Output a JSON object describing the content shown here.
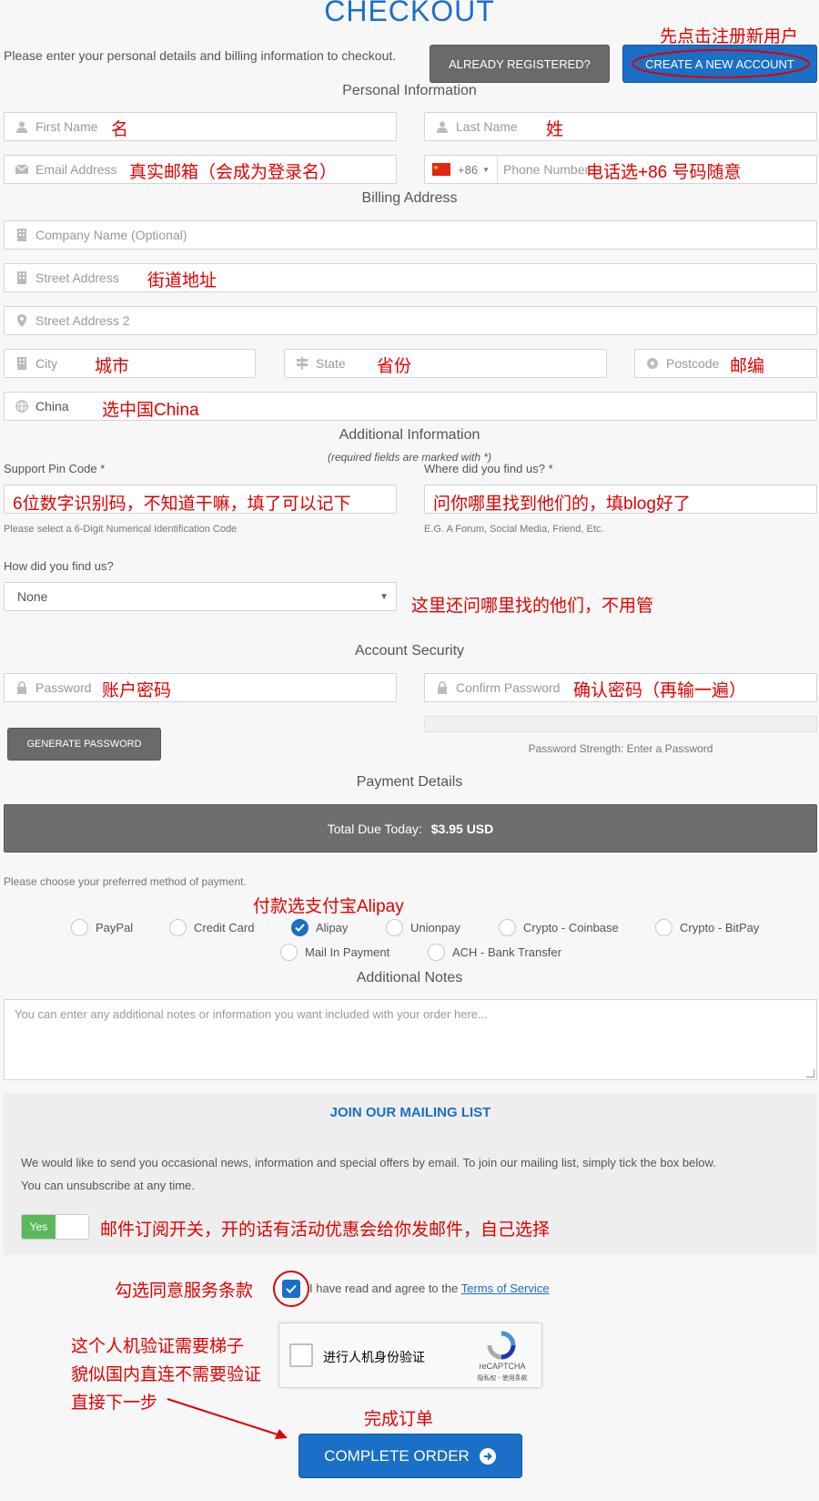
{
  "header": {
    "title": "CHECKOUT",
    "intro": "Please enter your personal details and billing information to checkout.",
    "already_registered": "ALREADY REGISTERED?",
    "create_account": "CREATE A NEW ACCOUNT"
  },
  "sections": {
    "personal": "Personal Information",
    "billing": "Billing Address",
    "additional": "Additional Information",
    "required_note": "(required fields are marked with *)",
    "security": "Account Security",
    "payment": "Payment Details",
    "notes": "Additional Notes"
  },
  "personal": {
    "first_name": "First Name",
    "last_name": "Last Name",
    "email": "Email Address",
    "phone_code": "+86",
    "phone": "Phone Number"
  },
  "billing": {
    "company": "Company Name (Optional)",
    "street": "Street Address",
    "street2": "Street Address 2",
    "city": "City",
    "state": "State",
    "postcode": "Postcode",
    "country": "China"
  },
  "additional": {
    "pin_label": "Support Pin Code *",
    "pin_help": "Please select a 6-Digit Numerical Identification Code",
    "where_label": "Where did you find us? *",
    "where_help": "E.G. A Forum, Social Media, Friend, Etc.",
    "how_label": "How did you find us?",
    "how_value": "None"
  },
  "security": {
    "password": "Password",
    "confirm": "Confirm Password",
    "generate": "GENERATE PASSWORD",
    "strength": "Password Strength: Enter a Password"
  },
  "payment": {
    "total_label": "Total Due Today:",
    "total_value": "$3.95 USD",
    "choose": "Please choose your preferred method of payment.",
    "methods": [
      "PayPal",
      "Credit Card",
      "Alipay",
      "Unionpay",
      "Crypto - Coinbase",
      "Crypto - BitPay",
      "Mail In Payment",
      "ACH - Bank Transfer"
    ],
    "selected": "Alipay"
  },
  "notes": {
    "placeholder": "You can enter any additional notes or information you want included with your order here..."
  },
  "mailing": {
    "title": "JOIN OUR MAILING LIST",
    "text1": "We would like to send you occasional news, information and special offers by email. To join our mailing list, simply tick the box below.",
    "text2": "You can unsubscribe at any time.",
    "toggle_yes": "Yes"
  },
  "tos": {
    "text": "I have read and agree to the",
    "link": "Terms of Service"
  },
  "captcha": {
    "label": "进行人机身份验证",
    "brand": "reCAPTCHA",
    "links": "隐私权 - 使用条款"
  },
  "complete": "COMPLETE ORDER",
  "annotations": {
    "create": "先点击注册新用户",
    "first_name": "名",
    "last_name": "姓",
    "email": "真实邮箱（会成为登录名）",
    "phone": "电话选+86 号码随意",
    "street": "街道地址",
    "city": "城市",
    "state": "省份",
    "postcode": "邮编",
    "country": "选中国China",
    "pin": "6位数字识别码，不知道干嘛，填了可以记下",
    "where": "问你哪里找到他们的，填blog好了",
    "how": "这里还问哪里找的他们，不用管",
    "password": "账户密码",
    "confirm": "确认密码（再输一遍）",
    "alipay": "付款选支付宝Alipay",
    "mailing": "邮件订阅开关，开的话有活动优惠会给你发邮件，自己选择",
    "tos": "勾选同意服务条款",
    "captcha_1": "这个人机验证需要梯子",
    "captcha_2": "貌似国内直连不需要验证",
    "captcha_3": "直接下一步",
    "complete": "完成订单"
  },
  "colors": {
    "accent_blue": "#1a6fc7",
    "annotation_red": "#e00000",
    "dark_button": "#6a6a6a",
    "toggle_green": "#5cb85c"
  }
}
